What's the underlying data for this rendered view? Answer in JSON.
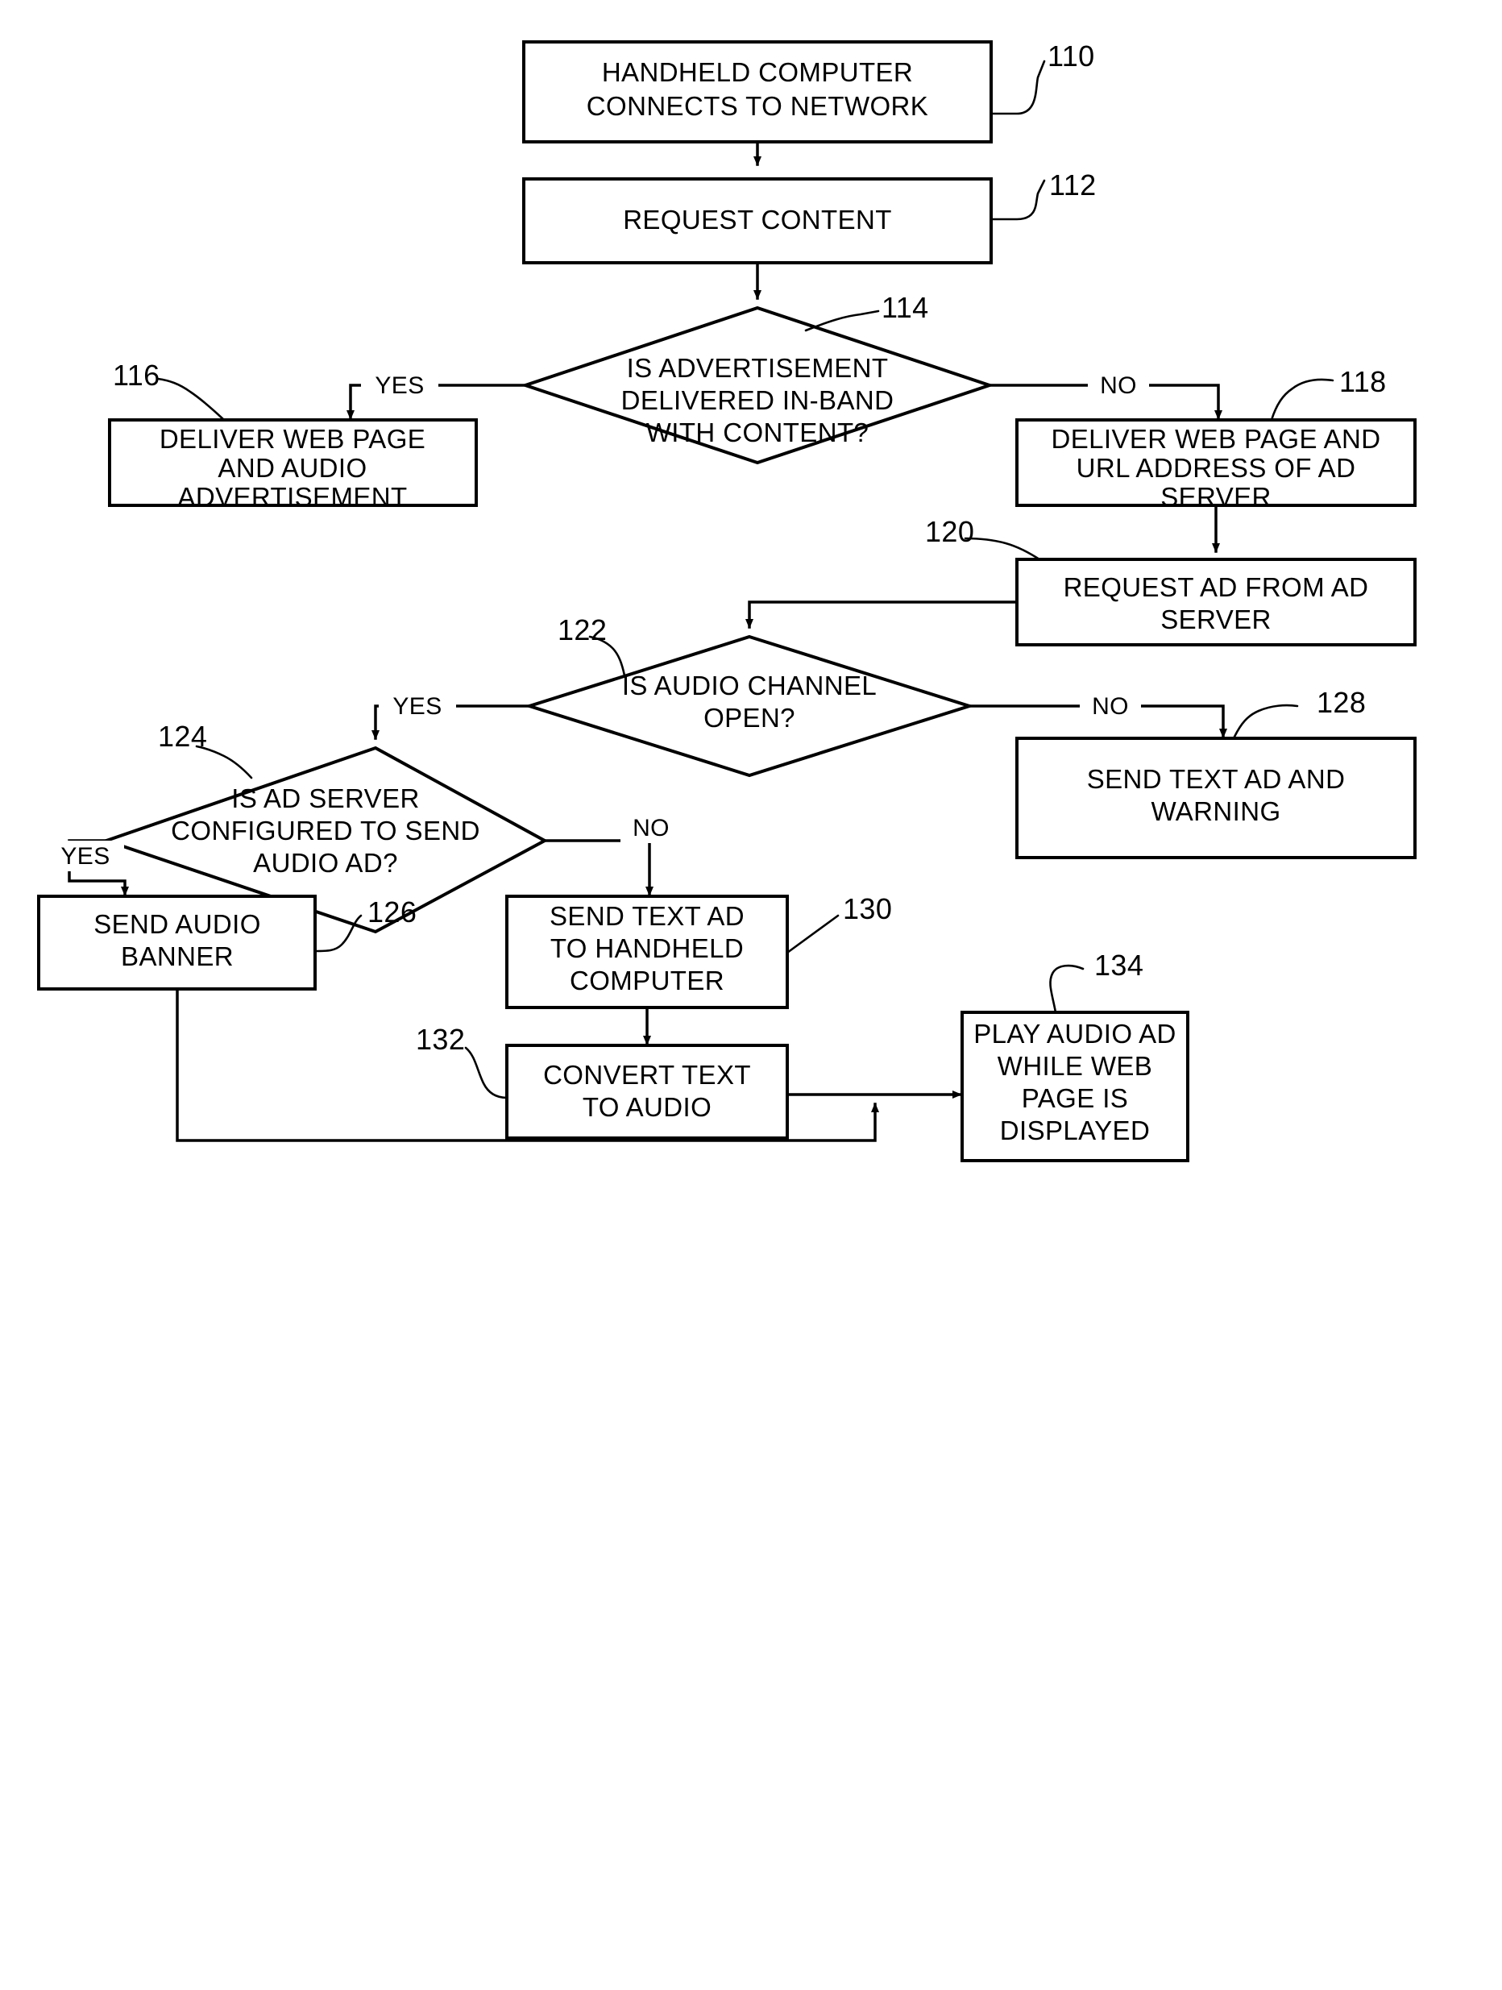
{
  "figure": {
    "type": "flowchart",
    "title": "",
    "background_color": "#ffffff",
    "line_color": "#000000"
  },
  "nodes": [
    {
      "ref": "110",
      "shape": "process",
      "lines": [
        "HANDHELD COMPUTER",
        "CONNECTS TO NETWORK"
      ]
    },
    {
      "ref": "112",
      "shape": "process",
      "lines": [
        "REQUEST CONTENT"
      ]
    },
    {
      "ref": "114",
      "shape": "decision",
      "lines": [
        "IS ADVERTISEMENT",
        "DELIVERED IN-BAND",
        "WITH CONTENT?"
      ]
    },
    {
      "ref": "116",
      "shape": "process",
      "lines": [
        "DELIVER WEB PAGE",
        "AND AUDIO",
        "ADVERTISEMENT"
      ]
    },
    {
      "ref": "118",
      "shape": "process",
      "lines": [
        "DELIVER WEB PAGE AND",
        "URL ADDRESS OF AD",
        "SERVER"
      ]
    },
    {
      "ref": "120",
      "shape": "process",
      "lines": [
        "REQUEST AD FROM AD",
        "SERVER"
      ]
    },
    {
      "ref": "122",
      "shape": "decision",
      "lines": [
        "IS AUDIO CHANNEL",
        "OPEN?"
      ]
    },
    {
      "ref": "124",
      "shape": "decision",
      "lines": [
        "IS AD SERVER",
        "CONFIGURED TO SEND",
        "AUDIO AD?"
      ]
    },
    {
      "ref": "126",
      "shape": "process",
      "lines": [
        "SEND AUDIO",
        "BANNER"
      ]
    },
    {
      "ref": "128",
      "shape": "process",
      "lines": [
        "SEND TEXT AD AND",
        "WARNING"
      ]
    },
    {
      "ref": "130",
      "shape": "process",
      "lines": [
        "SEND TEXT AD",
        "TO HANDHELD",
        "COMPUTER"
      ]
    },
    {
      "ref": "132",
      "shape": "process",
      "lines": [
        "CONVERT TEXT",
        "TO AUDIO"
      ]
    },
    {
      "ref": "134",
      "shape": "process",
      "lines": [
        "PLAY AUDIO AD",
        "WHILE WEB",
        "PAGE IS",
        "DISPLAYED"
      ]
    }
  ],
  "branch_labels": {
    "d114_yes": "YES",
    "d114_no": "NO",
    "d122_yes": "YES",
    "d122_no": "NO",
    "d124_yes": "YES",
    "d124_no": "NO"
  },
  "node_text": {
    "n110_l1": "HANDHELD COMPUTER",
    "n110_l2": "CONNECTS TO NETWORK",
    "n112_l1": "REQUEST CONTENT",
    "n114_l1": "IS ADVERTISEMENT",
    "n114_l2": "DELIVERED IN-BAND",
    "n114_l3": "WITH CONTENT?",
    "n116_l1": "DELIVER WEB PAGE",
    "n116_l2": "AND AUDIO",
    "n116_l3": "ADVERTISEMENT",
    "n118_l1": "DELIVER WEB PAGE AND",
    "n118_l2": "URL ADDRESS OF AD",
    "n118_l3": "SERVER",
    "n120_l1": "REQUEST AD FROM AD",
    "n120_l2": "SERVER",
    "n122_l1": "IS AUDIO CHANNEL",
    "n122_l2": "OPEN?",
    "n124_l1": "IS AD SERVER",
    "n124_l2": "CONFIGURED TO SEND",
    "n124_l3": "AUDIO AD?",
    "n126_l1": "SEND AUDIO",
    "n126_l2": "BANNER",
    "n128_l1": "SEND TEXT AD AND",
    "n128_l2": "WARNING",
    "n130_l1": "SEND TEXT AD",
    "n130_l2": "TO HANDHELD",
    "n130_l3": "COMPUTER",
    "n132_l1": "CONVERT TEXT",
    "n132_l2": "TO AUDIO",
    "n134_l1": "PLAY AUDIO AD",
    "n134_l2": "WHILE WEB",
    "n134_l3": "PAGE IS",
    "n134_l4": "DISPLAYED"
  },
  "ref_numbers": {
    "r110": "110",
    "r112": "112",
    "r114": "114",
    "r116": "116",
    "r118": "118",
    "r120": "120",
    "r122": "122",
    "r124": "124",
    "r126": "126",
    "r128": "128",
    "r130": "130",
    "r132": "132",
    "r134": "134"
  }
}
